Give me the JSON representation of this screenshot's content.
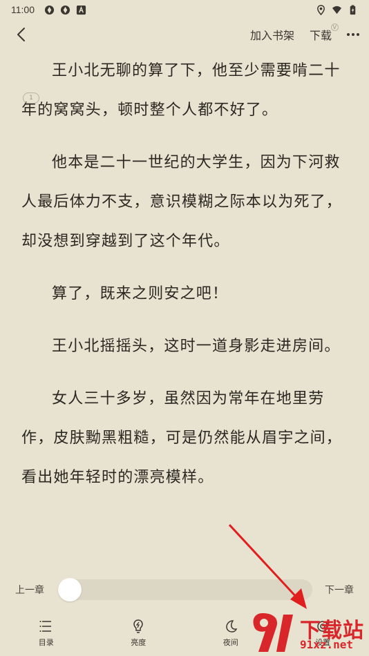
{
  "status_bar": {
    "time": "11:00"
  },
  "top_bar": {
    "add_shelf": "加入书架",
    "download": "下载",
    "download_badge": "V"
  },
  "content": {
    "paragraphs": [
      "王小北无聊的算了下，他至少需要啃二十年的窝窝头，顿时整个人都不好了。",
      "他本是二十一世纪的大学生，因为下河救人最后体力不支，意识模糊之际本以为死了，却没想到穿越到了这个年代。",
      "算了，既来之则安之吧！",
      "王小北摇摇头，这时一道身影走进房间。",
      "女人三十多岁，虽然因为常年在地里劳作，皮肤黝黑粗糙，可是仍然能从眉宇之间，看出她年轻时的漂亮模样。"
    ],
    "comment_count": "1"
  },
  "progress": {
    "prev_chapter": "上一章",
    "next_chapter": "下一章",
    "value": 0
  },
  "bottom_nav": {
    "items": [
      {
        "label": "目录",
        "icon": "list-icon"
      },
      {
        "label": "亮度",
        "icon": "brightness-icon"
      },
      {
        "label": "夜间",
        "icon": "moon-icon"
      },
      {
        "label": "设置",
        "icon": "settings-icon"
      }
    ]
  },
  "watermark": {
    "text": "下载站",
    "url": "91xz.net"
  },
  "colors": {
    "background": "#e8e2d0",
    "text": "#2b2721",
    "accent_red": "#d8262a"
  }
}
